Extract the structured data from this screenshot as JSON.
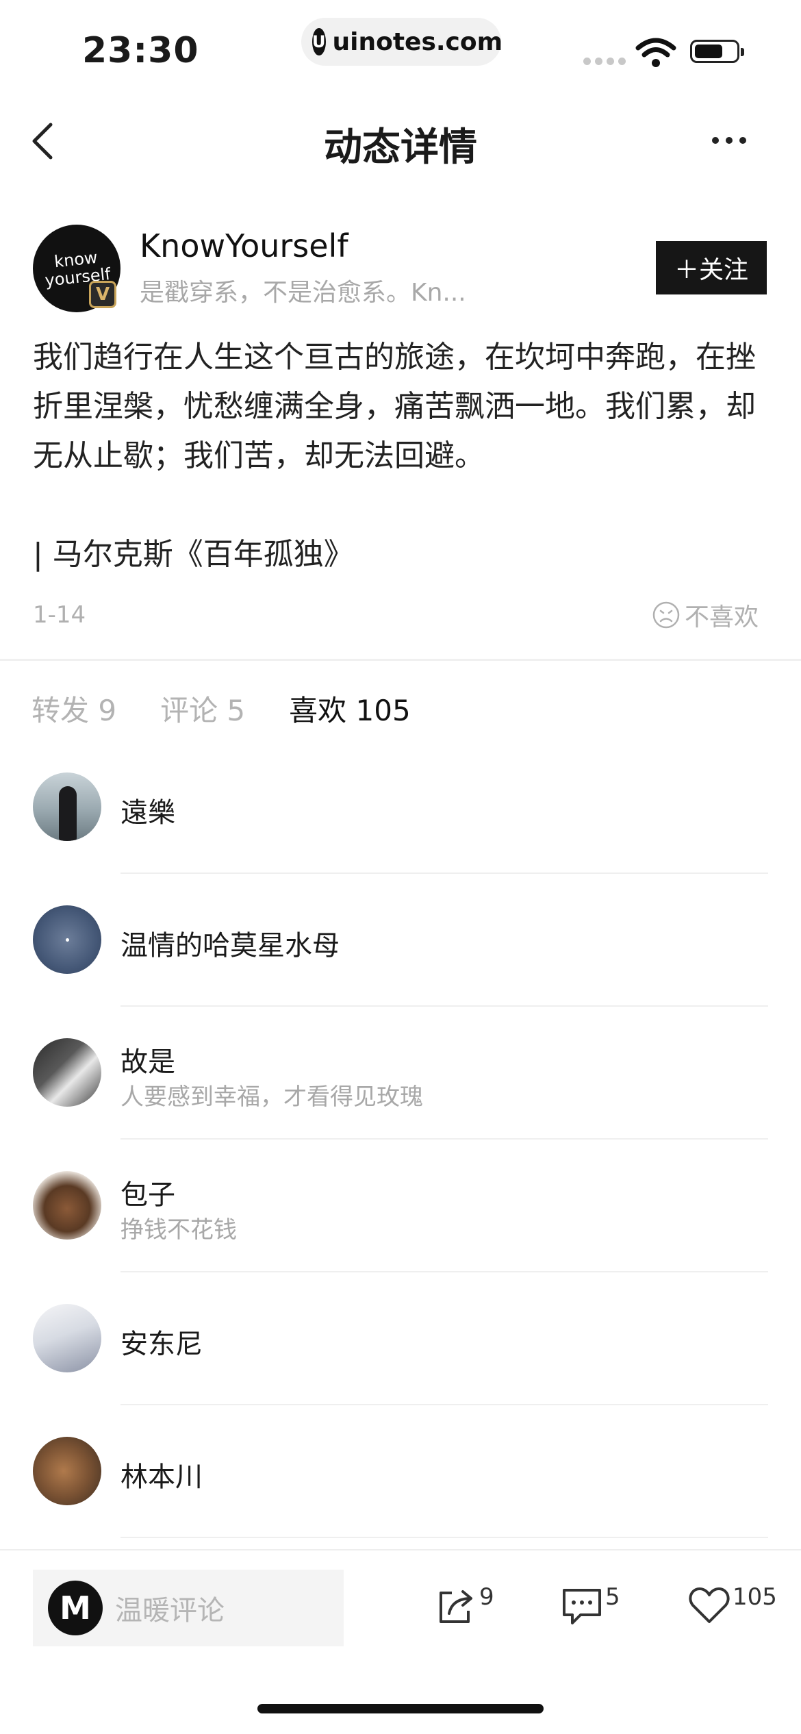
{
  "status": {
    "time": "23:30",
    "url": "uinotes.com"
  },
  "nav": {
    "title": "动态详情"
  },
  "author": {
    "name": "KnowYourself",
    "bio": "是戳穿系，不是治愈系。Kn...",
    "avatar_text_1": "know",
    "avatar_text_2": "yourself",
    "badge": "V",
    "follow_label": "＋关注"
  },
  "post": {
    "text": "我们趋行在人生这个亘古的旅途，在坎坷中奔跑，在挫折里涅槃，忧愁缠满全身，痛苦飘洒一地。我们累，却无从止歇；我们苦，却无法回避。",
    "quote": "| 马尔克斯《百年孤独》",
    "date": "1-14",
    "dislike_label": "不喜欢"
  },
  "tabs": [
    {
      "label": "转发 9"
    },
    {
      "label": "评论 5"
    },
    {
      "label": "喜欢 105"
    }
  ],
  "likers": [
    {
      "name": "遠樂",
      "sub": ""
    },
    {
      "name": "温情的哈莫星水母",
      "sub": ""
    },
    {
      "name": "故是",
      "sub": "人要感到幸福，才看得见玫瑰"
    },
    {
      "name": "包子",
      "sub": "挣钱不花钱"
    },
    {
      "name": "安东尼",
      "sub": ""
    },
    {
      "name": "林本川",
      "sub": ""
    }
  ],
  "bottom": {
    "comment_placeholder": "温暖评论",
    "comment_avatar_letter": "M",
    "share_count": "9",
    "comment_count": "5",
    "like_count": "105"
  }
}
